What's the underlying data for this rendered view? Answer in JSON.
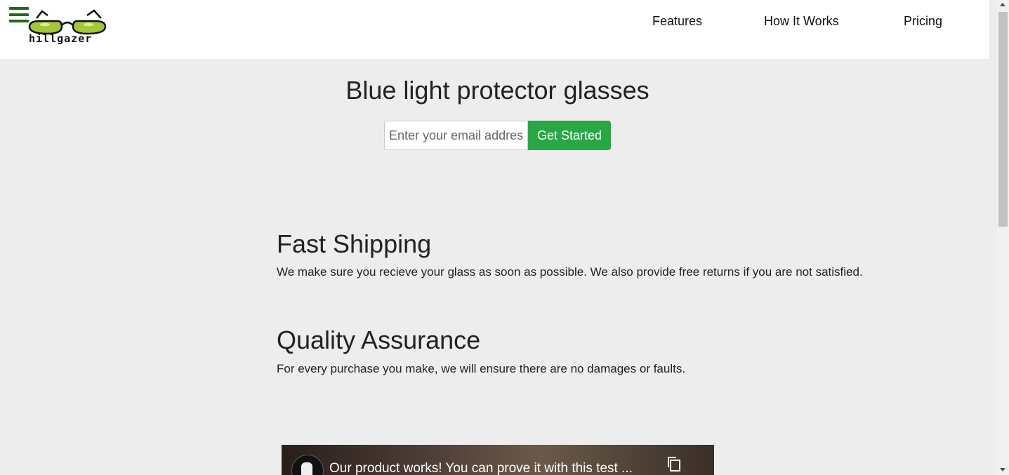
{
  "header": {
    "logo_text": "hillgazer",
    "nav": [
      {
        "label": "Features"
      },
      {
        "label": "How It Works"
      },
      {
        "label": "Pricing"
      }
    ]
  },
  "hero": {
    "title": "Blue light protector glasses",
    "email_placeholder": "Enter your email address",
    "cta_label": "Get Started"
  },
  "features": [
    {
      "title": "Fast Shipping",
      "description": "We make sure you recieve your glass as soon as possible. We also provide free returns if you are not satisfied."
    },
    {
      "title": "Quality Assurance",
      "description": "For every purchase you make, we will ensure there are no damages or faults."
    }
  ],
  "video": {
    "title": "Our product works! You can prove it with this test ..."
  },
  "colors": {
    "accent": "#28a745",
    "hamburger": "#1e6b1e",
    "lens": "#a4c639"
  },
  "icons": {
    "menu": "hamburger-menu-icon",
    "copy": "copy-link-icon"
  }
}
